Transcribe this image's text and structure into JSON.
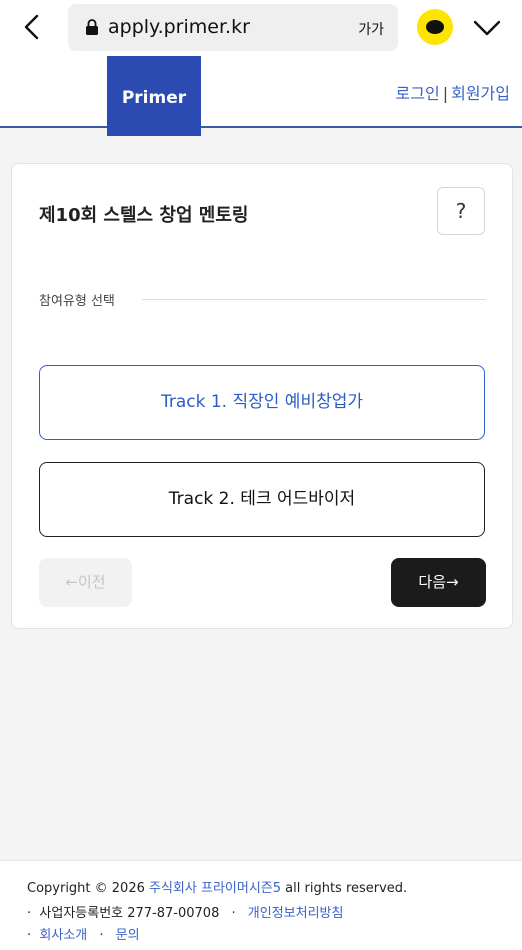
{
  "browser": {
    "url": "apply.primer.kr",
    "text_size_label": "가가"
  },
  "header": {
    "logo": "Primer",
    "login": "로그인",
    "separator": "|",
    "signup": "회원가입"
  },
  "card": {
    "title": "제10회 스텔스 창업 멘토링",
    "help_label": "?",
    "section_label": "참여유형 선택",
    "tracks": [
      {
        "label": "Track 1. 직장인 예비창업가",
        "selected": true
      },
      {
        "label": "Track 2. 테크 어드바이저",
        "selected": false
      }
    ],
    "prev_label": "←이전",
    "next_label": "다음→"
  },
  "footer": {
    "copyright_prefix": "Copyright © 2026",
    "company_link": "주식회사 프라이머시즌5",
    "copyright_suffix": "all rights reserved.",
    "bullet": "·",
    "biz_number": "사업자등록번호 277-87-00708",
    "privacy_link": "개인정보처리방침",
    "about_link": "회사소개",
    "contact_link": "문의"
  },
  "colors": {
    "brand_blue": "#2b4bb3",
    "link_blue": "#3a62c9",
    "kakao_yellow": "#fee500",
    "dark_button": "#1b1b1b"
  }
}
